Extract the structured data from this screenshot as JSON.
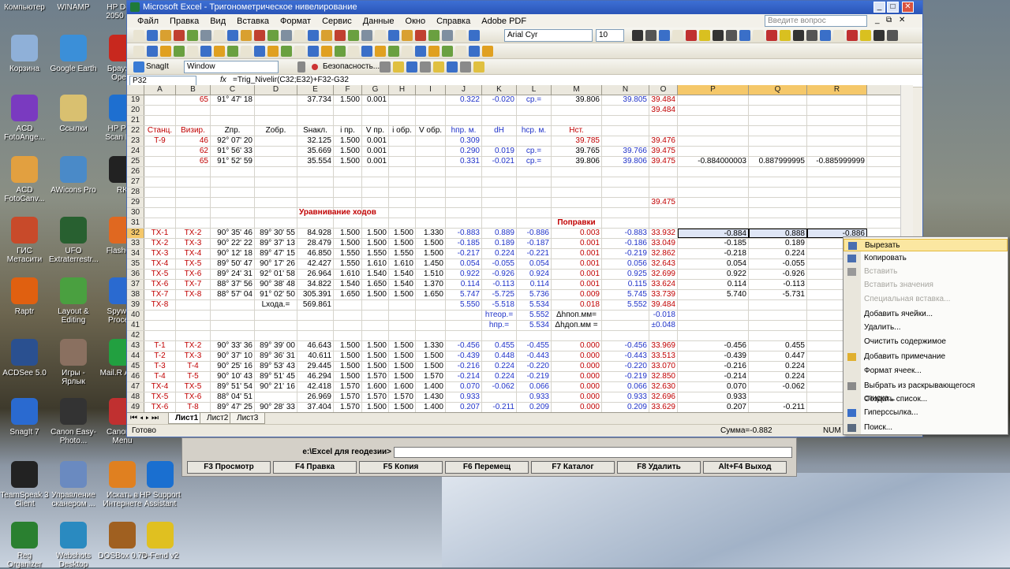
{
  "desktop_icons": [
    {
      "label": "Компьютер"
    },
    {
      "label": "WINAMP"
    },
    {
      "label": "HP Desk 2050 J51"
    },
    {
      "label": "Корзина"
    },
    {
      "label": "Google Earth"
    },
    {
      "label": "Браузер Opera"
    },
    {
      "label": "ACD FotoAnge..."
    },
    {
      "label": "Ссылки"
    },
    {
      "label": "HP Print Scan Doc"
    },
    {
      "label": "ACD FotoCanv..."
    },
    {
      "label": "AWicons Pro"
    },
    {
      "label": "RK"
    },
    {
      "label": "ГИС Метасити"
    },
    {
      "label": "UFO Extraterrestr..."
    },
    {
      "label": "FlashGet"
    },
    {
      "label": "Raptr"
    },
    {
      "label": "Layout & Editing"
    },
    {
      "label": "Spyware Process"
    },
    {
      "label": "ACDSee 5.0"
    },
    {
      "label": "Игры - Ярлык"
    },
    {
      "label": "Mail.R Агент"
    },
    {
      "label": "SnagIt 7"
    },
    {
      "label": "Canon Easy-Photo..."
    },
    {
      "label": "Canon Q Menu"
    },
    {
      "label": "TeamSpeak 3 Client"
    },
    {
      "label": "Управление сканером ..."
    },
    {
      "label": "Искать в Интернете"
    },
    {
      "label": "HP Support Assistant"
    },
    {
      "label": "Reg Organizer"
    },
    {
      "label": "Webshots Desktop"
    },
    {
      "label": "DOSBox 0.74"
    },
    {
      "label": "D-Fend v2"
    }
  ],
  "window": {
    "title": "Microsoft Excel - Тригонометрическое нивелирование",
    "min": "_",
    "max": "□",
    "close": "✕"
  },
  "menu": [
    "Файл",
    "Правка",
    "Вид",
    "Вставка",
    "Формат",
    "Сервис",
    "Данные",
    "Окно",
    "Справка",
    "Adobe PDF"
  ],
  "ask_placeholder": "Введите вопрос",
  "font_name": "Arial Cyr",
  "font_size": "10",
  "snagit": {
    "label": "SnagIt",
    "mode": "Window",
    "security": "Безопасность..."
  },
  "formula_bar": {
    "cell": "P32",
    "fx": "fx",
    "formula": "=Trig_Nivelir(C32;E32)+F32-G32"
  },
  "columns": [
    "A",
    "B",
    "C",
    "D",
    "E",
    "F",
    "G",
    "H",
    "I",
    "J",
    "K",
    "L",
    "M",
    "N",
    "O",
    "P",
    "Q",
    "R"
  ],
  "rows": [
    {
      "n": "19",
      "cells": [
        "",
        "65",
        "91° 47' 18",
        "",
        "37.734",
        "1.500",
        "0.001",
        "",
        "",
        "0.322",
        "-0.020",
        "ср.=",
        "39.806",
        "39.805",
        "39.484",
        "",
        "",
        ""
      ]
    },
    {
      "n": "20",
      "cells": [
        "",
        "",
        "",
        "",
        "",
        "",
        "",
        "",
        "",
        "",
        "",
        "",
        "",
        "",
        "39.484",
        "",
        "",
        ""
      ]
    },
    {
      "n": "21",
      "cells": [
        "",
        "",
        "",
        "",
        "",
        "",
        "",
        "",
        "",
        "",
        "",
        "",
        "",
        "",
        "",
        "",
        "",
        ""
      ]
    },
    {
      "n": "22",
      "cells": [
        "Станц.",
        "Визир.",
        "Zпр.",
        "Zобр.",
        "Sнакл.",
        "i пр.",
        "V пр.",
        "i обр.",
        "V обр.",
        "hпр. м.",
        "dH",
        "hср. м.",
        "Нст.",
        "",
        "",
        "",
        "",
        ""
      ]
    },
    {
      "n": "23",
      "cells": [
        "T-9",
        "46",
        "92° 07' 20",
        "",
        "32.125",
        "1.500",
        "0.001",
        "",
        "",
        "0.309",
        "",
        "",
        "39.785",
        "",
        "39.476",
        "",
        "",
        ""
      ]
    },
    {
      "n": "24",
      "cells": [
        "",
        "62",
        "91° 56' 33",
        "",
        "35.669",
        "1.500",
        "0.001",
        "",
        "",
        "0.290",
        "0.019",
        "ср.=",
        "39.765",
        "39.766",
        "39.475",
        "",
        "",
        ""
      ]
    },
    {
      "n": "25",
      "cells": [
        "",
        "65",
        "91° 52' 59",
        "",
        "35.554",
        "1.500",
        "0.001",
        "",
        "",
        "0.331",
        "-0.021",
        "ср.=",
        "39.806",
        "39.806",
        "39.475",
        "-0.884000003",
        "0.887999995",
        "-0.885999999"
      ]
    },
    {
      "n": "26",
      "cells": [
        "",
        "",
        "",
        "",
        "",
        "",
        "",
        "",
        "",
        "",
        "",
        "",
        "",
        "",
        "",
        "",
        "",
        ""
      ]
    },
    {
      "n": "27",
      "cells": [
        "",
        "",
        "",
        "",
        "",
        "",
        "",
        "",
        "",
        "",
        "",
        "",
        "",
        "",
        "",
        "",
        "",
        ""
      ]
    },
    {
      "n": "28",
      "cells": [
        "",
        "",
        "",
        "",
        "",
        "",
        "",
        "",
        "",
        "",
        "",
        "",
        "",
        "",
        "",
        "",
        "",
        ""
      ]
    },
    {
      "n": "29",
      "cells": [
        "",
        "",
        "",
        "",
        "",
        "",
        "",
        "",
        "",
        "",
        "",
        "",
        "",
        "",
        "39.475",
        "",
        "",
        ""
      ]
    },
    {
      "n": "30",
      "cells": [
        "",
        "",
        "",
        "",
        "Уравнивание ходов",
        "",
        "",
        "",
        "",
        "",
        "",
        "",
        "",
        "",
        "",
        "",
        "",
        ""
      ]
    },
    {
      "n": "31",
      "cells": [
        "",
        "",
        "",
        "",
        "",
        "",
        "",
        "",
        "",
        "",
        "",
        "",
        "Поправки",
        "",
        "",
        "",
        "",
        ""
      ]
    },
    {
      "n": "32",
      "cells": [
        "TX-1",
        "TX-2",
        "90° 35' 46",
        "89° 30' 55",
        "84.928",
        "1.500",
        "1.500",
        "1.500",
        "1.330",
        "-0.883",
        "0.889",
        "-0.886",
        "0.003",
        "-0.883",
        "33.932",
        "-0.884",
        "0.888",
        "-0.886"
      ]
    },
    {
      "n": "33",
      "cells": [
        "TX-2",
        "TX-3",
        "90° 22' 22",
        "89° 37' 13",
        "28.479",
        "1.500",
        "1.500",
        "1.500",
        "1.500",
        "-0.185",
        "0.189",
        "-0.187",
        "0.001",
        "-0.186",
        "33.049",
        "-0.185",
        "0.189",
        ""
      ]
    },
    {
      "n": "34",
      "cells": [
        "TX-3",
        "TX-4",
        "90° 12' 18",
        "89° 47' 15",
        "46.850",
        "1.550",
        "1.550",
        "1.550",
        "1.500",
        "-0.217",
        "0.224",
        "-0.221",
        "0.001",
        "-0.219",
        "32.862",
        "-0.218",
        "0.224",
        ""
      ]
    },
    {
      "n": "35",
      "cells": [
        "TX-4",
        "TX-5",
        "89° 50' 47",
        "90° 17' 26",
        "42.427",
        "1.550",
        "1.610",
        "1.610",
        "1.450",
        "0.054",
        "-0.055",
        "0.054",
        "0.001",
        "0.056",
        "32.643",
        "0.054",
        "-0.055",
        ""
      ]
    },
    {
      "n": "36",
      "cells": [
        "TX-5",
        "TX-6",
        "89° 24' 31",
        "92° 01' 58",
        "26.964",
        "1.610",
        "1.540",
        "1.540",
        "1.510",
        "0.922",
        "-0.926",
        "0.924",
        "0.001",
        "0.925",
        "32.699",
        "0.922",
        "-0.926",
        ""
      ]
    },
    {
      "n": "37",
      "cells": [
        "TX-6",
        "TX-7",
        "88° 37' 56",
        "90° 38' 48",
        "34.822",
        "1.540",
        "1.650",
        "1.540",
        "1.370",
        "0.114",
        "-0.113",
        "0.114",
        "0.001",
        "0.115",
        "33.624",
        "0.114",
        "-0.113",
        ""
      ]
    },
    {
      "n": "38",
      "cells": [
        "TX-7",
        "TX-8",
        "88° 57' 04",
        "91° 02' 50",
        "305.391",
        "1.650",
        "1.500",
        "1.500",
        "1.650",
        "5.747",
        "-5.725",
        "5.736",
        "0.009",
        "5.745",
        "33.739",
        "5.740",
        "-5.731",
        ""
      ]
    },
    {
      "n": "39",
      "cells": [
        "TX-8",
        "",
        "",
        "Lхода.=",
        "569.861",
        "",
        "",
        "",
        "",
        "5.550",
        "-5.518",
        "5.534",
        "0.018",
        "5.552",
        "39.484",
        "",
        "",
        ""
      ]
    },
    {
      "n": "40",
      "cells": [
        "",
        "",
        "",
        "",
        "",
        "",
        "",
        "",
        "",
        "",
        "hтеор.=",
        "5.552",
        "Δhпоп.мм=",
        "",
        "-0.018",
        "",
        "",
        ""
      ]
    },
    {
      "n": "41",
      "cells": [
        "",
        "",
        "",
        "",
        "",
        "",
        "",
        "",
        "",
        "",
        "hпр.=",
        "5.534",
        "Δhдоп.мм =",
        "",
        "±0.048",
        "",
        "",
        ""
      ]
    },
    {
      "n": "42",
      "cells": [
        "",
        "",
        "",
        "",
        "",
        "",
        "",
        "",
        "",
        "",
        "",
        "",
        "",
        "",
        "",
        "",
        "",
        ""
      ]
    },
    {
      "n": "43",
      "cells": [
        "T-1",
        "TX-2",
        "90° 33' 36",
        "89° 39' 00",
        "46.643",
        "1.500",
        "1.500",
        "1.500",
        "1.330",
        "-0.456",
        "0.455",
        "-0.455",
        "0.000",
        "-0.456",
        "33.969",
        "-0.456",
        "0.455",
        ""
      ]
    },
    {
      "n": "44",
      "cells": [
        "T-2",
        "TX-3",
        "90° 37' 10",
        "89° 36' 31",
        "40.611",
        "1.500",
        "1.500",
        "1.500",
        "1.500",
        "-0.439",
        "0.448",
        "-0.443",
        "0.000",
        "-0.443",
        "33.513",
        "-0.439",
        "0.447",
        ""
      ]
    },
    {
      "n": "45",
      "cells": [
        "T-3",
        "T-4",
        "90° 25' 16",
        "89° 53' 43",
        "29.445",
        "1.500",
        "1.500",
        "1.500",
        "1.500",
        "-0.216",
        "0.224",
        "-0.220",
        "0.000",
        "-0.220",
        "33.070",
        "-0.216",
        "0.224",
        ""
      ]
    },
    {
      "n": "46",
      "cells": [
        "T-4",
        "T-5",
        "90° 10' 43",
        "89° 51' 45",
        "46.294",
        "1.500",
        "1.570",
        "1.500",
        "1.570",
        "-0.214",
        "0.224",
        "-0.219",
        "0.000",
        "-0.219",
        "32.850",
        "-0.214",
        "0.224",
        ""
      ]
    },
    {
      "n": "47",
      "cells": [
        "TX-4",
        "TX-5",
        "89° 51' 54",
        "90° 21' 16",
        "42.418",
        "1.570",
        "1.600",
        "1.600",
        "1.400",
        "0.070",
        "-0.062",
        "0.066",
        "0.000",
        "0.066",
        "32.630",
        "0.070",
        "-0.062",
        ""
      ]
    },
    {
      "n": "48",
      "cells": [
        "TX-5",
        "TX-6",
        "88° 04' 51",
        "",
        "26.969",
        "1.570",
        "1.570",
        "1.570",
        "1.430",
        "0.933",
        "",
        "0.933",
        "0.000",
        "0.933",
        "32.696",
        "0.933",
        "",
        ""
      ]
    },
    {
      "n": "49",
      "cells": [
        "TX-6",
        "T-8",
        "89° 47' 25",
        "90° 28' 33",
        "37.404",
        "1.570",
        "1.500",
        "1.500",
        "1.400",
        "0.207",
        "-0.211",
        "0.209",
        "0.000",
        "0.209",
        "33.629",
        "0.207",
        "-0.211",
        ""
      ]
    }
  ],
  "sheets": [
    "Лист1",
    "Лист2",
    "Лист3"
  ],
  "status": {
    "ready": "Готово",
    "sum": "Сумма=-0.882",
    "num": "NUM"
  },
  "context_menu": [
    {
      "label": "Вырезать",
      "enabled": true,
      "highlighted": true
    },
    {
      "label": "Копировать",
      "enabled": true
    },
    {
      "label": "Вставить",
      "enabled": false
    },
    {
      "label": "Вставить значения",
      "enabled": false
    },
    {
      "label": "Специальная вставка...",
      "enabled": false
    },
    {
      "label": "Добавить ячейки...",
      "enabled": true
    },
    {
      "label": "Удалить...",
      "enabled": true
    },
    {
      "label": "Очистить содержимое",
      "enabled": true
    },
    {
      "label": "Добавить примечание",
      "enabled": true
    },
    {
      "label": "Формат ячеек...",
      "enabled": true
    },
    {
      "label": "Выбрать из раскрывающегося списка...",
      "enabled": true
    },
    {
      "label": "Создать список...",
      "enabled": true
    },
    {
      "label": "Гиперссылка...",
      "enabled": true
    },
    {
      "label": "Поиск...",
      "enabled": true
    }
  ],
  "dos_panel": {
    "path": "e:\\Excel для геодезии>",
    "keys": [
      "F3 Просмотр",
      "F4 Правка",
      "F5 Копия",
      "F6 Перемещ",
      "F7 Каталог",
      "F8 Удалить",
      "Alt+F4 Выход"
    ]
  }
}
